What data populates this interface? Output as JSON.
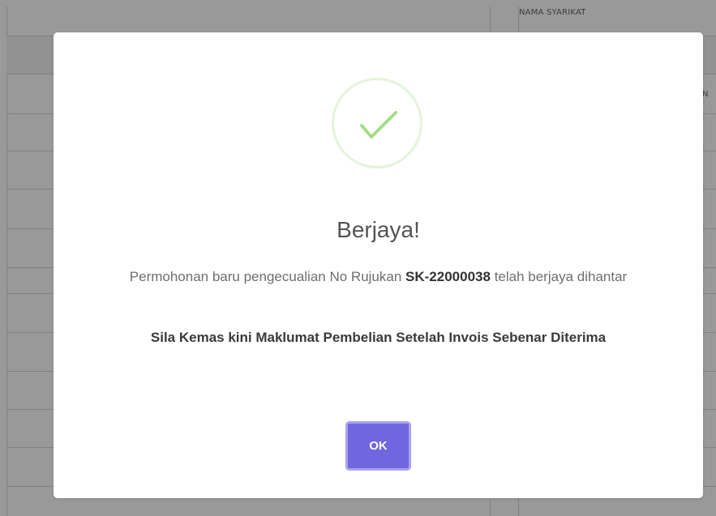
{
  "background": {
    "column_header": "NAMA SYARIKAT",
    "column_header_partial": "N"
  },
  "dialog": {
    "icon": "check-icon",
    "title": "Berjaya!",
    "message_prefix": "Permohonan baru pengecualian No Rujukan",
    "reference_no": "SK-22000038",
    "message_suffix": "telah berjaya dihantar",
    "note": "Sila Kemas kini Maklumat Pembelian Setelah Invois Sebenar Diterima",
    "ok_label": "OK"
  },
  "colors": {
    "confirm_button": "#7066e0",
    "success_check": "#a5dc86",
    "overlay": "rgba(0,0,0,0.40)"
  }
}
